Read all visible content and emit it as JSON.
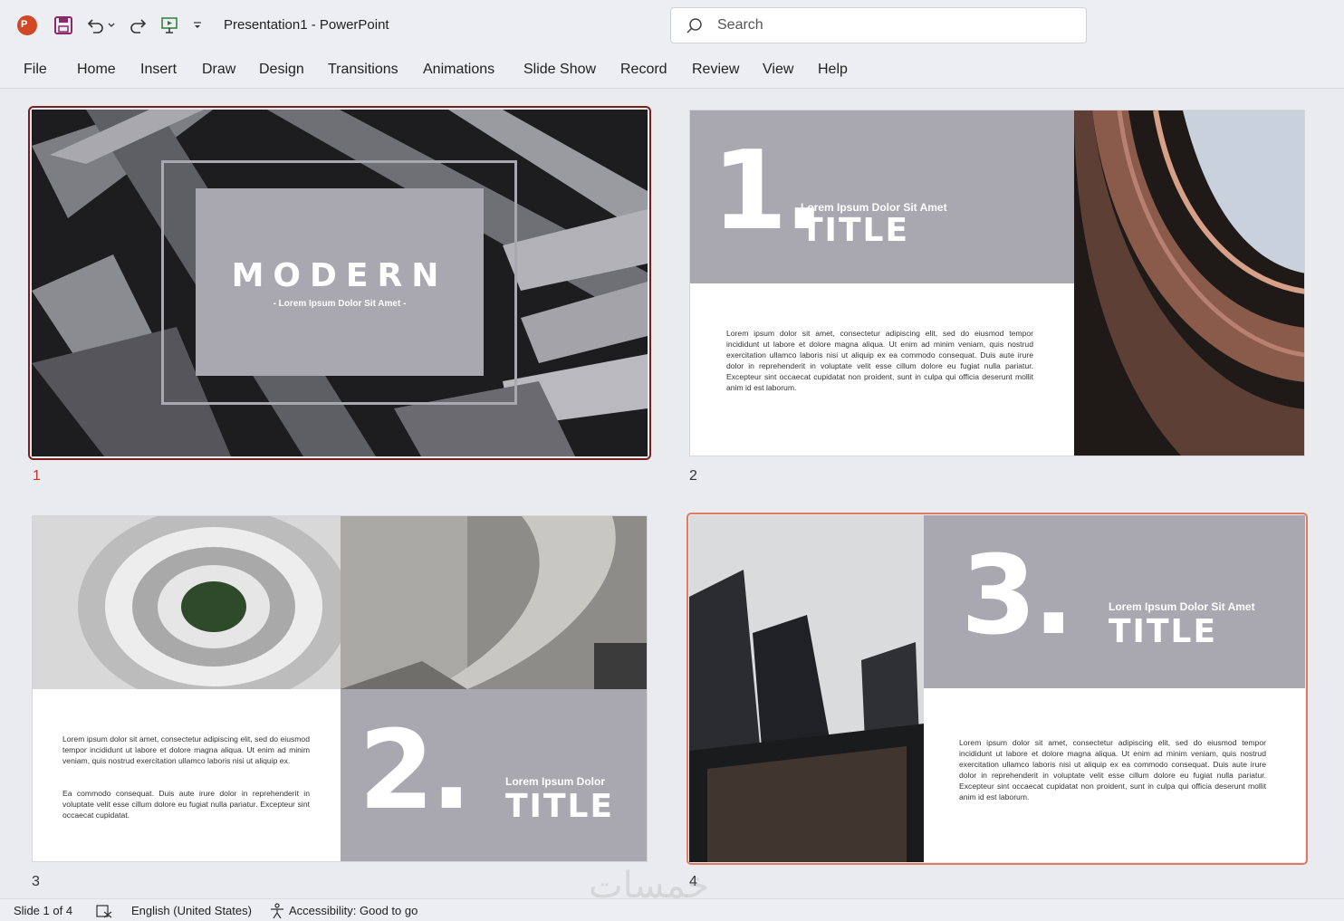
{
  "titlebar": {
    "doc_title": "Presentation1  -  PowerPoint",
    "icons": [
      "powerpoint-logo-icon",
      "save-icon",
      "undo-icon",
      "redo-icon",
      "present-icon",
      "customize-toolbar-icon"
    ]
  },
  "search": {
    "placeholder": "Search"
  },
  "ribbon": {
    "tabs": [
      "File",
      "Home",
      "Insert",
      "Draw",
      "Design",
      "Transitions",
      "Animations",
      "Slide Show",
      "Record",
      "Review",
      "View",
      "Help"
    ]
  },
  "slides": [
    {
      "number": "1",
      "title": "MODERN",
      "subtitle": "- Lorem Ipsum Dolor Sit Amet -"
    },
    {
      "number": "2",
      "big": "1.",
      "heading": "Lorem Ipsum Dolor Sit Amet",
      "title": "TITLE",
      "body": "Lorem ipsum dolor sit amet, consectetur adipiscing elit, sed do eiusmod tempor incididunt ut labore et dolore magna aliqua. Ut enim ad minim veniam, quis nostrud exercitation ullamco laboris nisi ut aliquip ex ea commodo consequat. Duis aute irure dolor in reprehenderit in voluptate velit esse cillum dolore eu fugiat nulla pariatur. Excepteur sint occaecat cupidatat non proident, sunt in culpa qui officia deserunt mollit anim id est laborum."
    },
    {
      "number": "3",
      "big": "2.",
      "heading": "Lorem Ipsum Dolor",
      "title": "TITLE",
      "body1": "Lorem ipsum dolor sit amet, consectetur adipiscing elit, sed do eiusmod tempor incididunt ut labore et dolore magna aliqua. Ut enim ad minim veniam, quis nostrud exercitation ullamco laboris nisi ut aliquip ex.",
      "body2": "Ea commodo consequat. Duis aute irure dolor in reprehenderit in voluptate velit esse cillum dolore eu fugiat nulla pariatur. Excepteur sint occaecat cupidatat."
    },
    {
      "number": "4",
      "big": "3.",
      "heading": "Lorem Ipsum Dolor Sit Amet",
      "title": "TITLE",
      "body": "Lorem ipsum dolor sit amet, consectetur adipiscing elit, sed do eiusmod tempor incididunt ut labore et dolore magna aliqua. Ut enim ad minim veniam, quis nostrud exercitation ullamco laboris nisi ut aliquip ex ea commodo consequat. Duis aute irure dolor in reprehenderit in voluptate velit esse cillum dolore eu fugiat nulla pariatur. Excepteur sint occaecat cupidatat non proident, sunt in culpa qui officia deserunt mollit anim id est laborum."
    }
  ],
  "statusbar": {
    "slide_info": "Slide 1 of 4",
    "language": "English (United States)",
    "accessibility": "Accessibility: Good to go"
  },
  "colors": {
    "selected_border": "#7a1f1f",
    "hover_border": "#e07a63",
    "panel_gray": "#a9a8b1",
    "accent": "#c0392b"
  },
  "watermark": "خمسات"
}
